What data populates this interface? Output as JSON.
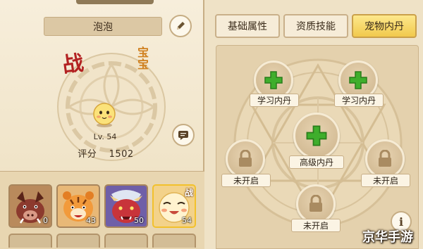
{
  "pet": {
    "name": "泡泡",
    "level_label": "Lv. 54",
    "score_label": "评分",
    "score_value": "1502",
    "battle_glyph": "战",
    "baby_glyph": "宝宝"
  },
  "pets": [
    {
      "name": "boar",
      "count": "0"
    },
    {
      "name": "tiger",
      "count": "43"
    },
    {
      "name": "red-beast",
      "count": "50"
    },
    {
      "name": "egg",
      "count": "54",
      "tag": "战",
      "selected": true
    }
  ],
  "tabs": [
    {
      "label": "基础属性"
    },
    {
      "label": "资质技能"
    },
    {
      "label": "宠物内丹",
      "active": true
    }
  ],
  "inner_pills": {
    "top_left": "学习内丹",
    "top_right": "学习内丹",
    "center": "高级内丹",
    "mid_left": "未开启",
    "mid_right": "未开启",
    "bottom": "未开启"
  },
  "watermark": "京华手游",
  "colors": {
    "accent_gold": "#f1c94d",
    "plus_green": "#3fae2c",
    "battle_red": "#b32222",
    "panel_bg": "#efe2c6"
  },
  "icons": {
    "edit": "pencil-icon",
    "message": "chat-icon",
    "add": "plus-icon",
    "locked": "lock-icon",
    "info": "info-icon"
  }
}
